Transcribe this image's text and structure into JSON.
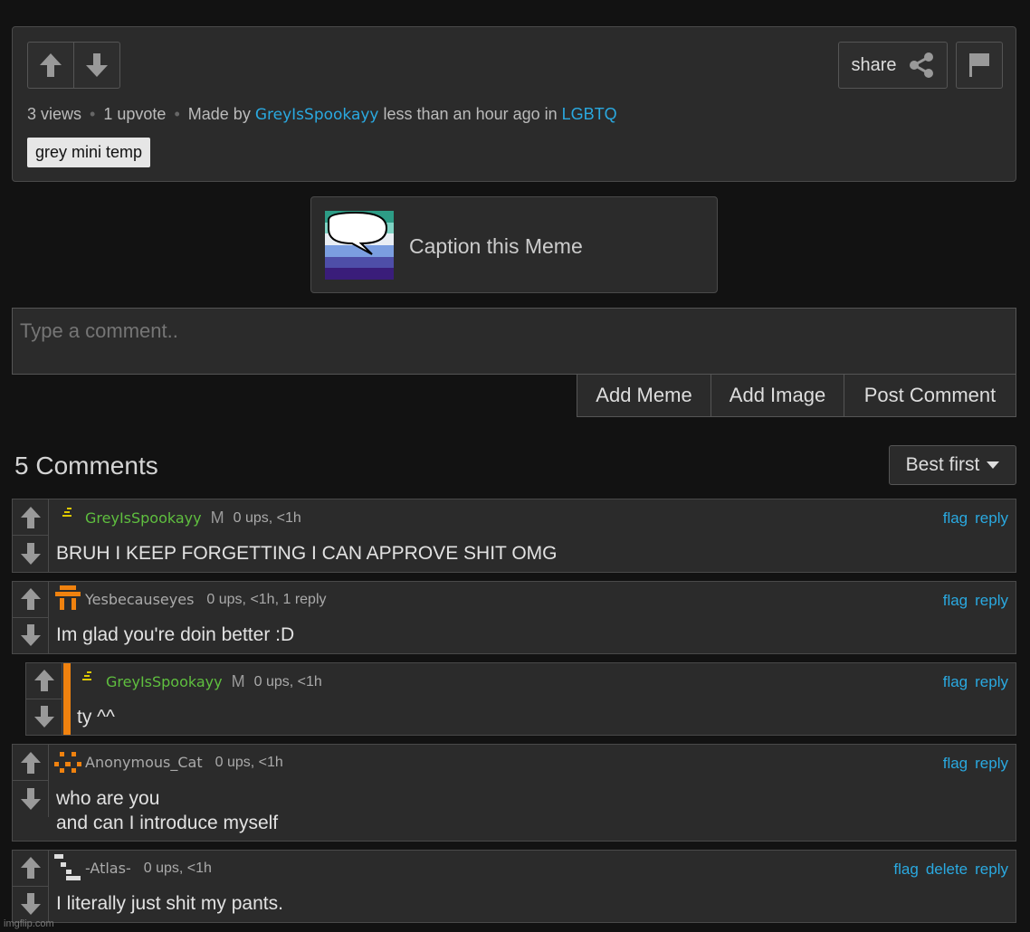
{
  "header": {
    "views": "3 views",
    "upvotes": "1 upvote",
    "made_by": "Made by",
    "author": "GreyIsSpookayy",
    "time": "less than an hour ago in",
    "stream": "LGBTQ",
    "template_tag": "grey mini temp",
    "share_label": "share"
  },
  "caption": {
    "label": "Caption this Meme"
  },
  "comment_box": {
    "placeholder": "Type a comment..",
    "add_meme": "Add Meme",
    "add_image": "Add Image",
    "post_comment": "Post Comment"
  },
  "comments_header": {
    "count_label": "5 Comments",
    "sort_label": "Best first"
  },
  "comments": [
    {
      "user": "GreyIsSpookayy",
      "mod_badge": "M",
      "meta": "0 ups, <1h",
      "text": "BRUH I KEEP FORGETTING I CAN APPROVE SHIT OMG",
      "user_color": "#5fbf3f",
      "actions": [
        "flag",
        "reply"
      ]
    },
    {
      "user": "Yesbecauseyes",
      "meta": "0 ups, <1h, 1 reply",
      "text": "Im glad you're doin better :D",
      "user_color": "#aaaaaa",
      "actions": [
        "flag",
        "reply"
      ]
    },
    {
      "user": "GreyIsSpookayy",
      "mod_badge": "M",
      "meta": "0 ups, <1h",
      "text": "ty ^^",
      "user_color": "#5fbf3f",
      "actions": [
        "flag",
        "reply"
      ]
    },
    {
      "user": "Anonymous_Cat",
      "meta": "0 ups, <1h",
      "text_line1": "who are you",
      "text_line2": "and can I introduce myself",
      "user_color": "#aaaaaa",
      "actions": [
        "flag",
        "reply"
      ]
    },
    {
      "user": "-Atlas-",
      "meta": "0 ups, <1h",
      "text": "I literally just shit my pants.",
      "user_color": "#aaaaaa",
      "actions": [
        "flag",
        "delete",
        "reply"
      ]
    }
  ],
  "watermark": "imgflip.com",
  "icons": {
    "upvote": "up-arrow-icon",
    "downvote": "down-arrow-icon",
    "share": "share-icon",
    "flag": "flag-icon",
    "dropdown": "caret-down-icon"
  },
  "colors": {
    "link": "#2aa9e0",
    "mod_user": "#5fbf3f",
    "reply_bar": "#f0820f",
    "background": "#121212",
    "panel": "#2b2b2b"
  }
}
